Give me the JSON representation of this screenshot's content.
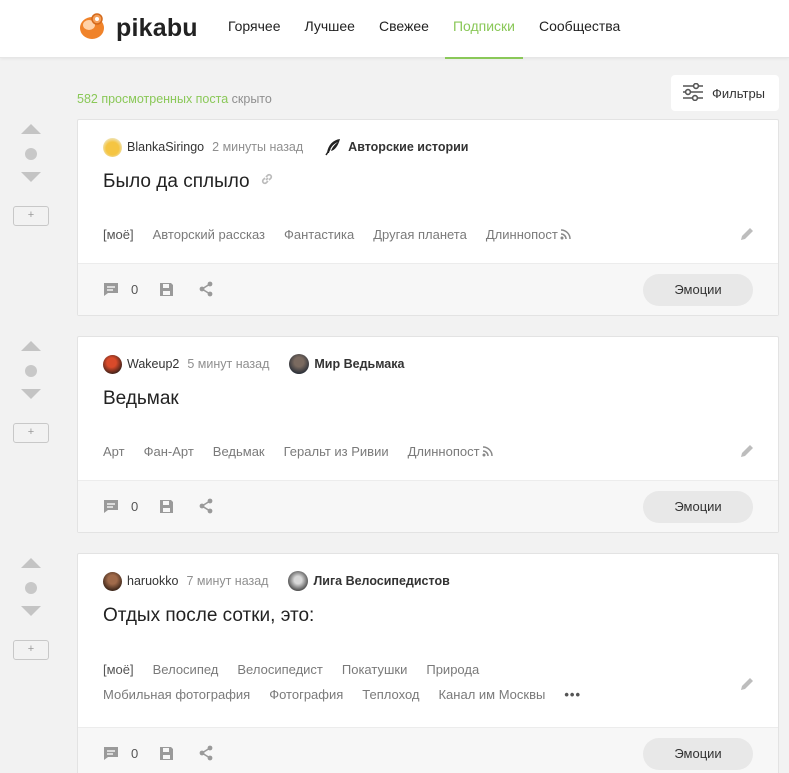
{
  "header": {
    "logo_text": "pikabu",
    "nav": [
      {
        "label": "Горячее"
      },
      {
        "label": "Лучшее"
      },
      {
        "label": "Свежее"
      },
      {
        "label": "Подписки",
        "active": true
      },
      {
        "label": "Сообщества"
      }
    ]
  },
  "feed": {
    "viewed_count": "582 просмотренных поста",
    "viewed_suffix": " скрыто",
    "filters_label": "Фильтры"
  },
  "posts": [
    {
      "author": "BlankaSiringo",
      "time": "2 минуты назад",
      "community": "Авторские истории",
      "title": "Было да сплыло",
      "tags": [
        "[моё]",
        "Авторский рассказ",
        "Фантастика",
        "Другая планета",
        "Длиннопост"
      ],
      "comments": "0",
      "emotions_label": "Эмоции"
    },
    {
      "author": "Wakeup2",
      "time": "5 минут назад",
      "community": "Мир Ведьмака",
      "title": "Ведьмак",
      "tags": [
        "Арт",
        "Фан-Арт",
        "Ведьмак",
        "Геральт из Ривии",
        "Длиннопост"
      ],
      "comments": "0",
      "emotions_label": "Эмоции"
    },
    {
      "author": "haruokko",
      "time": "7 минут назад",
      "community": "Лига Велосипедистов",
      "title": "Отдых после сотки, это:",
      "tags": [
        "[моё]",
        "Велосипед",
        "Велосипедист",
        "Покатушки",
        "Природа",
        "Мобильная фотография",
        "Фотография",
        "Теплоход",
        "Канал им Москвы"
      ],
      "more_tags": "•••",
      "comments": "0",
      "emotions_label": "Эмоции"
    }
  ],
  "colors": {
    "accent": "#8ac858",
    "logo": "#f0832a"
  }
}
